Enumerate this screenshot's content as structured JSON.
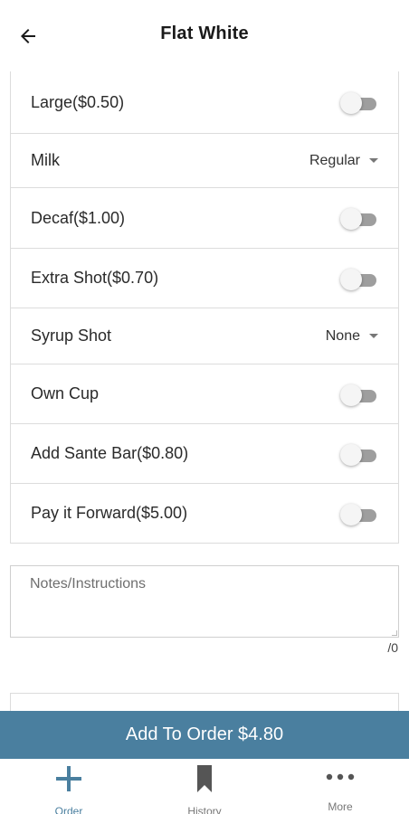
{
  "header": {
    "title": "Flat White",
    "back_icon": "arrow-left-icon"
  },
  "options": [
    {
      "label": "Large($0.50)",
      "type": "toggle",
      "on": false
    },
    {
      "label": "Milk",
      "type": "select",
      "value": "Regular"
    },
    {
      "label": "Decaf($1.00)",
      "type": "toggle",
      "on": false
    },
    {
      "label": "Extra Shot($0.70)",
      "type": "toggle",
      "on": false
    },
    {
      "label": "Syrup Shot",
      "type": "select",
      "value": "None"
    },
    {
      "label": "Own Cup",
      "type": "toggle",
      "on": false
    },
    {
      "label": "Add Sante Bar($0.80)",
      "type": "toggle",
      "on": false
    },
    {
      "label": "Pay it Forward($5.00)",
      "type": "toggle",
      "on": false
    }
  ],
  "notes": {
    "placeholder": "Notes/Instructions",
    "value": "",
    "char_count": "/0"
  },
  "add_button": {
    "label": "Add To Order $4.80"
  },
  "bottom_nav": [
    {
      "label": "Order",
      "icon": "plus-icon",
      "active": true
    },
    {
      "label": "History",
      "icon": "bookmark-icon",
      "active": false
    },
    {
      "label": "More",
      "icon": "more-dots-icon",
      "active": false
    }
  ],
  "colors": {
    "accent": "#4a7f9f",
    "toggle_track_off": "#9e9e9e",
    "border": "#dcdcdc"
  }
}
